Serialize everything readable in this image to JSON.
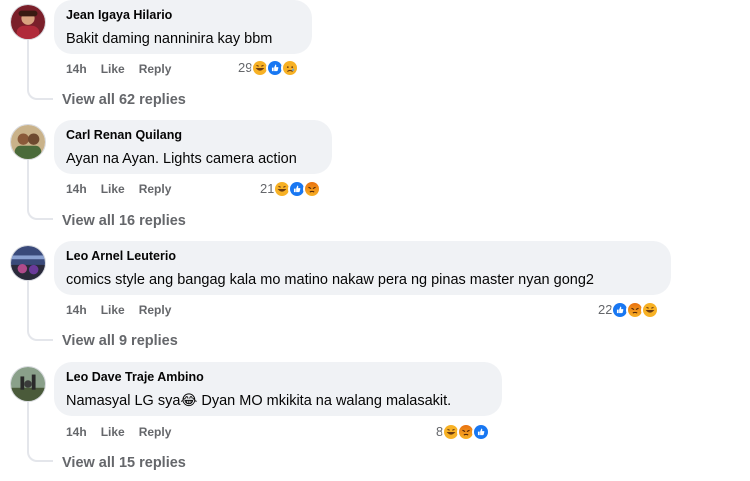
{
  "comments": [
    {
      "author": "Jean Igaya Hilario",
      "text": "Bakit daming nanninira kay bbm",
      "time": "14h",
      "like_label": "Like",
      "reply_label": "Reply",
      "reaction_count": "29",
      "reactions": [
        "haha",
        "like",
        "sad"
      ],
      "view_replies": "View all 62 replies"
    },
    {
      "author": "Carl Renan Quilang",
      "text": "Ayan na Ayan. Lights camera action",
      "time": "14h",
      "like_label": "Like",
      "reply_label": "Reply",
      "reaction_count": "21",
      "reactions": [
        "haha",
        "like",
        "angry"
      ],
      "view_replies": "View all 16 replies"
    },
    {
      "author": "Leo Arnel Leuterio",
      "text": "comics style ang bangag kala mo matino nakaw pera ng pinas master nyan gong2",
      "time": "14h",
      "like_label": "Like",
      "reply_label": "Reply",
      "reaction_count": "22",
      "reactions": [
        "like",
        "angry",
        "haha"
      ],
      "view_replies": "View all 9 replies"
    },
    {
      "author": "Leo Dave Traje Ambino",
      "text": "Namasyal LG sya😂 Dyan MO mkikita na walang malasakit.",
      "time": "14h",
      "like_label": "Like",
      "reply_label": "Reply",
      "reaction_count": "8",
      "reactions": [
        "haha",
        "angry",
        "like"
      ],
      "view_replies": "View all 15 replies"
    }
  ],
  "colors": {
    "bubble": "#f0f2f5",
    "meta_text": "#65676b",
    "like_blue": "#1877f2",
    "haha_yellow": "#f7b125",
    "angry_orange": "#e9710f"
  }
}
